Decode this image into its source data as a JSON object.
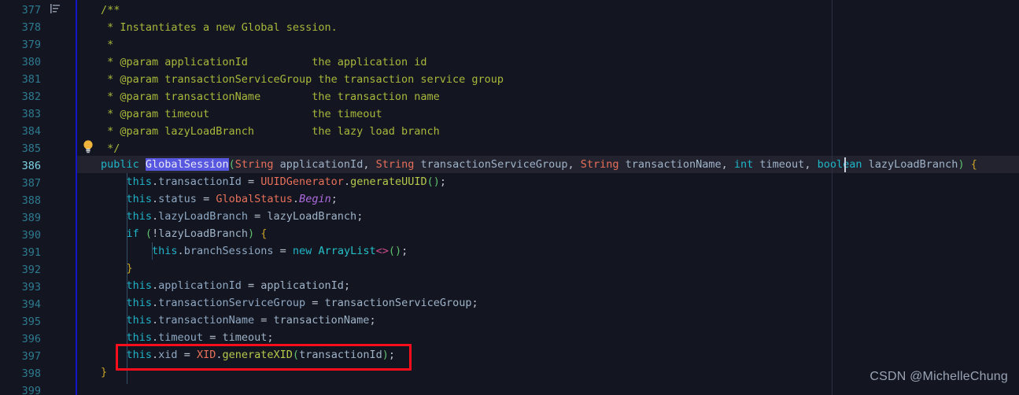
{
  "editor": {
    "background": "#131620",
    "current_line_background": "#23232f",
    "scope_guide_color": "#1414c8",
    "ruler_color": "#2b3040",
    "gutter_number_color": "#2e7a91",
    "gutter_current_number_color": "#7fd3e8",
    "selection_color": "#5757e0",
    "annotation_box_color": "#fc0d1b",
    "first_line_number": 377,
    "last_line_number": 399,
    "current_line_number": 386,
    "icons": {
      "fold": "code-fold-icon",
      "intention": "lightbulb-icon"
    }
  },
  "lines": [
    {
      "n": 377,
      "text": "    /**"
    },
    {
      "n": 378,
      "text": "     * Instantiates a new Global session."
    },
    {
      "n": 379,
      "text": "     *"
    },
    {
      "n": 380,
      "text": "     * @param applicationId          the application id"
    },
    {
      "n": 381,
      "text": "     * @param transactionServiceGroup the transaction service group"
    },
    {
      "n": 382,
      "text": "     * @param transactionName        the transaction name"
    },
    {
      "n": 383,
      "text": "     * @param timeout                the timeout"
    },
    {
      "n": 384,
      "text": "     * @param lazyLoadBranch         the lazy load branch"
    },
    {
      "n": 385,
      "text": "     */"
    },
    {
      "n": 386,
      "text": "    public GlobalSession(String applicationId, String transactionServiceGroup, String transactionName, int timeout, boolean lazyLoadBranch) {"
    },
    {
      "n": 387,
      "text": "        this.transactionId = UUIDGenerator.generateUUID();"
    },
    {
      "n": 388,
      "text": "        this.status = GlobalStatus.Begin;"
    },
    {
      "n": 389,
      "text": "        this.lazyLoadBranch = lazyLoadBranch;"
    },
    {
      "n": 390,
      "text": "        if (!lazyLoadBranch) {"
    },
    {
      "n": 391,
      "text": "            this.branchSessions = new ArrayList<>();"
    },
    {
      "n": 392,
      "text": "        }"
    },
    {
      "n": 393,
      "text": "        this.applicationId = applicationId;"
    },
    {
      "n": 394,
      "text": "        this.transactionServiceGroup = transactionServiceGroup;"
    },
    {
      "n": 395,
      "text": "        this.transactionName = transactionName;"
    },
    {
      "n": 396,
      "text": "        this.timeout = timeout;"
    },
    {
      "n": 397,
      "text": "        this.xid = XID.generateXID(transactionId);"
    },
    {
      "n": 398,
      "text": "    }"
    },
    {
      "n": 399,
      "text": ""
    }
  ],
  "highlighted_line": {
    "number": 397,
    "text": "this.xid = XID.generateXID(transactionId);"
  },
  "selection": {
    "line": 386,
    "text": "GlobalSession"
  },
  "watermark": {
    "text": "CSDN @MichelleChung"
  }
}
